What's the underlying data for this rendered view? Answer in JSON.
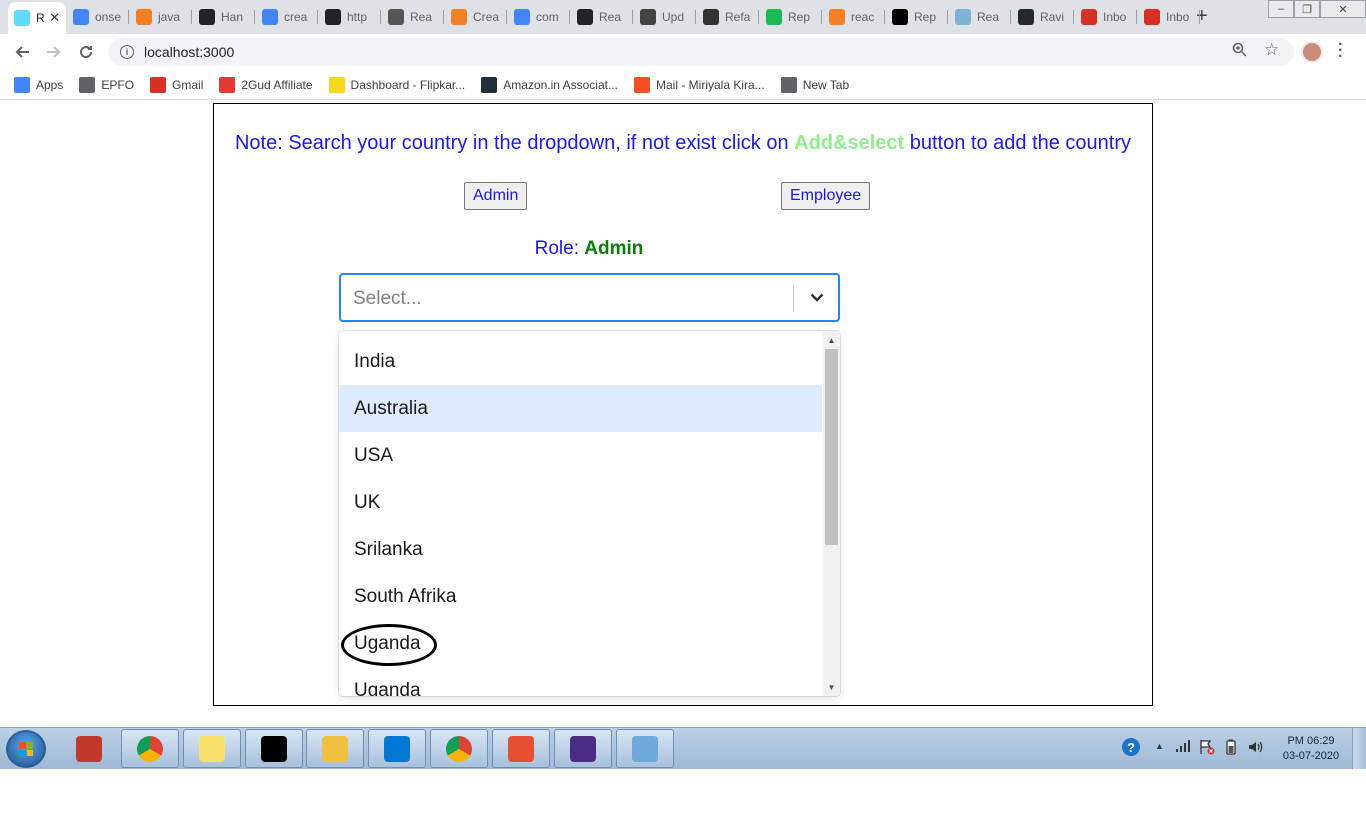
{
  "browser": {
    "tabs": [
      {
        "title": "R",
        "active": true,
        "favicon_color": "#61dafb",
        "icon": "react-icon"
      },
      {
        "title": "onse",
        "favicon_color": "#4285f4",
        "icon": "google-icon"
      },
      {
        "title": "java",
        "favicon_color": "#f48024",
        "icon": "stackoverflow-icon"
      },
      {
        "title": "Han",
        "favicon_color": "#20232a",
        "icon": "react-icon"
      },
      {
        "title": "crea",
        "favicon_color": "#4285f4",
        "icon": "google-icon"
      },
      {
        "title": "http",
        "favicon_color": "#20232a",
        "icon": "react-icon"
      },
      {
        "title": "Rea",
        "favicon_color": "#555555",
        "icon": "diamond-icon"
      },
      {
        "title": "Crea",
        "favicon_color": "#f48024",
        "icon": "chevron-icon"
      },
      {
        "title": "com",
        "favicon_color": "#4285f4",
        "icon": "google-icon"
      },
      {
        "title": "Rea",
        "favicon_color": "#20232a",
        "icon": "react-icon"
      },
      {
        "title": "Upd",
        "favicon_color": "#444444",
        "icon": "book-icon"
      },
      {
        "title": "Refa",
        "favicon_color": "#333333",
        "icon": "glasses-icon"
      },
      {
        "title": "Rep",
        "favicon_color": "#1db954",
        "icon": "power-icon"
      },
      {
        "title": "reac",
        "favicon_color": "#f48024",
        "icon": "stackoverflow-icon"
      },
      {
        "title": "Rep",
        "favicon_color": "#000000",
        "icon": "medium-icon"
      },
      {
        "title": "Rea",
        "favicon_color": "#7fb3d5",
        "icon": "page-icon"
      },
      {
        "title": "Ravi",
        "favicon_color": "#24292e",
        "icon": "github-icon"
      },
      {
        "title": "Inbo",
        "favicon_color": "#d93025",
        "icon": "gmail-icon"
      },
      {
        "title": "Inbo",
        "favicon_color": "#d93025",
        "icon": "gmail-icon"
      }
    ],
    "url": "localhost:3000",
    "bookmarks": [
      {
        "label": "Apps",
        "icon": "apps-grid-icon",
        "color": "#4285f4"
      },
      {
        "label": "EPFO",
        "icon": "globe-icon",
        "color": "#5f6368"
      },
      {
        "label": "Gmail",
        "icon": "gmail-icon",
        "color": "#d93025"
      },
      {
        "label": "2Gud Affiliate",
        "icon": "2gud-icon",
        "color": "#e53935"
      },
      {
        "label": "Dashboard - Flipkar...",
        "icon": "flipkart-icon",
        "color": "#f9d71c"
      },
      {
        "label": "Amazon.in Associat...",
        "icon": "amazon-icon",
        "color": "#232f3e"
      },
      {
        "label": "Mail - Miriyala Kira...",
        "icon": "microsoft-icon",
        "color": "#f25022"
      },
      {
        "label": "New Tab",
        "icon": "globe-icon",
        "color": "#5f6368"
      }
    ]
  },
  "page": {
    "note_prefix": "Note: Search your country in the dropdown, if not exist click on ",
    "note_highlight": "Add&select",
    "note_suffix": " button to add the country",
    "admin_button": "Admin",
    "employee_button": "Employee",
    "role_label": "Role: ",
    "role_value": "Admin",
    "select_placeholder": "Select...",
    "options": [
      "India",
      "Australia",
      "USA",
      "UK",
      "Srilanka",
      "South Afrika",
      "Uganda",
      "Uganda"
    ],
    "focused_option": 1
  },
  "taskbar": {
    "items": [
      {
        "icon": "snipping-tool-icon",
        "color": "#c0392b"
      },
      {
        "icon": "chrome-icon",
        "color": "#4285f4"
      },
      {
        "icon": "sticky-notes-icon",
        "color": "#f7e36b"
      },
      {
        "icon": "command-prompt-icon",
        "color": "#000000"
      },
      {
        "icon": "file-explorer-icon",
        "color": "#f0c040"
      },
      {
        "icon": "vscode-icon",
        "color": "#0078d4"
      },
      {
        "icon": "chrome-icon",
        "color": "#4285f4"
      },
      {
        "icon": "git-icon",
        "color": "#e84e31"
      },
      {
        "icon": "eclipse-javaee-icon",
        "color": "#4b2c84"
      },
      {
        "icon": "paint-icon",
        "color": "#6fa8dc"
      }
    ],
    "time": "PM 06:29",
    "date": "03-07-2020"
  }
}
